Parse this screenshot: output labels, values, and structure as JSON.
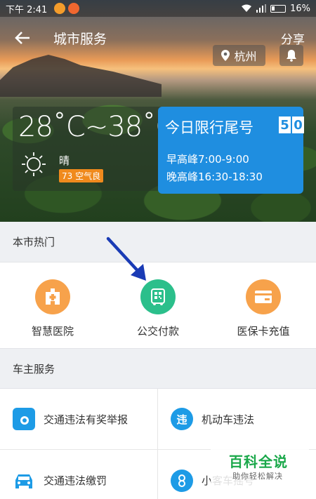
{
  "status_bar": {
    "time": "下午 2:41",
    "battery": "16%"
  },
  "header": {
    "title": "城市服务",
    "share_label": "分享",
    "city": "杭州"
  },
  "weather": {
    "temperature": "28˚C~38˚C",
    "condition": "晴",
    "aqi": "73 空气良"
  },
  "traffic_limit": {
    "title": "今日限行尾号",
    "numbers": [
      "5",
      "0"
    ],
    "morning_peak": "早高峰7:00-9:00",
    "evening_peak": "晚高峰16:30-18:30"
  },
  "hot_section": {
    "title": "本市热门",
    "items": [
      {
        "label": "智慧医院",
        "icon": "hospital-icon"
      },
      {
        "label": "公交付款",
        "icon": "bus-pay-icon"
      },
      {
        "label": "医保卡充值",
        "icon": "card-recharge-icon"
      }
    ]
  },
  "owner_section": {
    "title": "车主服务",
    "items": [
      {
        "label": "交通违法有奖举报",
        "icon": "camera-icon"
      },
      {
        "label": "机动车违法",
        "icon": "violation-icon",
        "glyph": "违"
      },
      {
        "label": "交通违法缴罚",
        "icon": "car-icon"
      },
      {
        "label": "小客车摇号",
        "icon": "lottery-icon"
      }
    ]
  },
  "watermark": {
    "main": "百科全说",
    "sub": "助你轻松解决"
  },
  "colors": {
    "accent_blue": "#1f8ee0",
    "hot_orange": "#f7a24b",
    "hot_green": "#2bbf8b",
    "aqi_orange": "#f08a1d",
    "annotation_arrow": "#1a3bb5"
  }
}
